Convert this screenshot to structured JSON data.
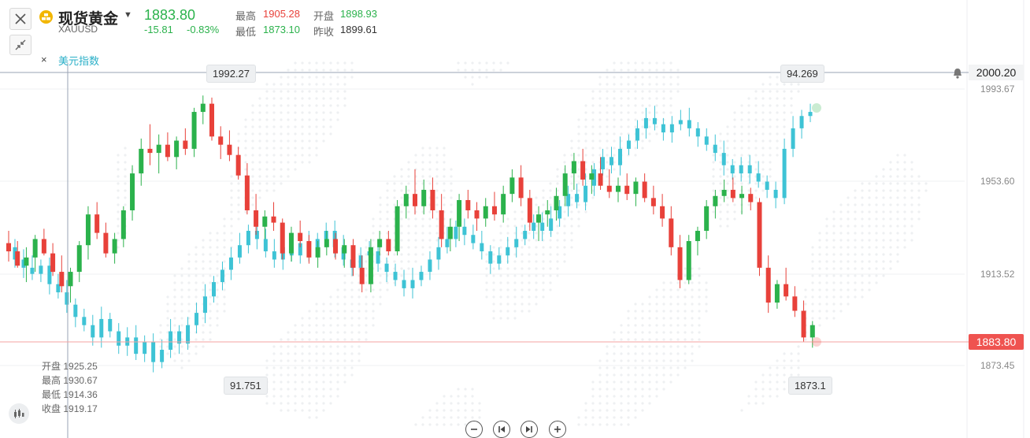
{
  "header": {
    "symbol_name": "现货黄金",
    "symbol_code": "XAUUSD",
    "last_price": "1883.80",
    "change": "-15.81",
    "change_pct": "-0.83%",
    "high_label": "最高",
    "high_value": "1905.28",
    "open_label": "开盘",
    "open_value": "1898.93",
    "low_label": "最低",
    "low_value": "1873.10",
    "prev_close_label": "昨收",
    "prev_close_value": "1899.61"
  },
  "indicator": {
    "close_glyph": "×",
    "name": "美元指数"
  },
  "crosshair": {
    "price_label": "2000.20"
  },
  "current_price_label": "1883.80",
  "annotations": {
    "gold_max": "1992.27",
    "gold_min": "1873.1",
    "dxy_max": "94.269",
    "dxy_min": "91.751"
  },
  "ohlc_panel": {
    "open_label": "开盘",
    "open_value": "1925.25",
    "high_label": "最高",
    "high_value": "1930.67",
    "low_label": "最低",
    "low_value": "1914.36",
    "close_label": "收盘",
    "close_value": "1919.17"
  },
  "colors": {
    "up": "#2bb24c",
    "down": "#e8413a",
    "dxy": "#3ec3d5",
    "accent_red": "#ef5350"
  },
  "chart_data": {
    "type": "candlestick",
    "y_axis": {
      "ticks": [
        "1993.67",
        "1953.60",
        "1913.52",
        "1873.45"
      ],
      "range": [
        1862,
        2008
      ]
    },
    "series": [
      {
        "name": "现货黄金",
        "ohlc": [
          [
            1924,
            1930,
            1915,
            1920
          ],
          [
            1920,
            1925,
            1912,
            1913
          ],
          [
            1913,
            1922,
            1905,
            1917
          ],
          [
            1917,
            1928,
            1910,
            1926
          ],
          [
            1926,
            1931,
            1918,
            1919
          ],
          [
            1919,
            1924,
            1908,
            1910
          ],
          [
            1910,
            1918,
            1900,
            1903
          ],
          [
            1903,
            1912,
            1895,
            1910
          ],
          [
            1910,
            1925,
            1905,
            1923
          ],
          [
            1923,
            1942,
            1916,
            1938
          ],
          [
            1938,
            1944,
            1926,
            1929
          ],
          [
            1929,
            1934,
            1917,
            1919
          ],
          [
            1919,
            1929,
            1914,
            1926
          ],
          [
            1926,
            1942,
            1922,
            1940
          ],
          [
            1940,
            1962,
            1935,
            1958
          ],
          [
            1958,
            1975,
            1952,
            1970
          ],
          [
            1970,
            1982,
            1962,
            1968
          ],
          [
            1968,
            1977,
            1958,
            1972
          ],
          [
            1972,
            1978,
            1964,
            1966
          ],
          [
            1966,
            1976,
            1960,
            1974
          ],
          [
            1974,
            1980,
            1967,
            1970
          ],
          [
            1970,
            1990,
            1966,
            1988
          ],
          [
            1988,
            1996,
            1982,
            1992
          ],
          [
            1992,
            1995,
            1974,
            1976
          ],
          [
            1976,
            1981,
            1965,
            1972
          ],
          [
            1972,
            1979,
            1964,
            1967
          ],
          [
            1967,
            1971,
            1955,
            1957
          ],
          [
            1957,
            1963,
            1938,
            1940
          ],
          [
            1940,
            1948,
            1928,
            1932
          ],
          [
            1932,
            1940,
            1926,
            1937
          ],
          [
            1937,
            1944,
            1930,
            1934
          ],
          [
            1934,
            1936,
            1916,
            1919
          ],
          [
            1919,
            1932,
            1915,
            1929
          ],
          [
            1929,
            1935,
            1922,
            1925
          ],
          [
            1925,
            1928,
            1914,
            1917
          ],
          [
            1917,
            1925,
            1912,
            1922
          ],
          [
            1922,
            1930,
            1918,
            1926
          ],
          [
            1926,
            1929,
            1916,
            1919
          ],
          [
            1919,
            1926,
            1912,
            1923
          ],
          [
            1923,
            1926,
            1908,
            1912
          ],
          [
            1912,
            1918,
            1900,
            1904
          ],
          [
            1904,
            1926,
            1900,
            1922
          ],
          [
            1922,
            1930,
            1918,
            1926
          ],
          [
            1926,
            1930,
            1918,
            1920
          ],
          [
            1920,
            1945,
            1918,
            1942
          ],
          [
            1942,
            1952,
            1936,
            1948
          ],
          [
            1948,
            1960,
            1938,
            1942
          ],
          [
            1942,
            1955,
            1938,
            1950
          ],
          [
            1950,
            1956,
            1936,
            1940
          ],
          [
            1940,
            1948,
            1922,
            1926
          ],
          [
            1926,
            1936,
            1920,
            1932
          ],
          [
            1932,
            1948,
            1925,
            1945
          ],
          [
            1945,
            1950,
            1936,
            1940
          ],
          [
            1940,
            1944,
            1930,
            1936
          ],
          [
            1936,
            1946,
            1932,
            1942
          ],
          [
            1942,
            1949,
            1935,
            1938
          ],
          [
            1938,
            1952,
            1934,
            1948
          ],
          [
            1948,
            1960,
            1944,
            1956
          ],
          [
            1956,
            1962,
            1942,
            1946
          ],
          [
            1946,
            1950,
            1930,
            1934
          ],
          [
            1934,
            1942,
            1925,
            1938
          ],
          [
            1938,
            1945,
            1932,
            1940
          ],
          [
            1940,
            1951,
            1935,
            1947
          ],
          [
            1947,
            1962,
            1942,
            1958
          ],
          [
            1958,
            1968,
            1950,
            1964
          ],
          [
            1964,
            1970,
            1952,
            1955
          ],
          [
            1955,
            1962,
            1948,
            1958
          ],
          [
            1958,
            1966,
            1950,
            1952
          ],
          [
            1952,
            1960,
            1946,
            1949
          ],
          [
            1949,
            1956,
            1944,
            1952
          ],
          [
            1952,
            1958,
            1945,
            1948
          ],
          [
            1948,
            1956,
            1942,
            1954
          ],
          [
            1954,
            1958,
            1944,
            1946
          ],
          [
            1946,
            1952,
            1938,
            1942
          ],
          [
            1942,
            1948,
            1932,
            1936
          ],
          [
            1936,
            1942,
            1918,
            1922
          ],
          [
            1922,
            1928,
            1902,
            1906
          ],
          [
            1906,
            1928,
            1904,
            1925
          ],
          [
            1925,
            1932,
            1918,
            1930
          ],
          [
            1930,
            1945,
            1926,
            1942
          ],
          [
            1942,
            1950,
            1936,
            1947
          ],
          [
            1947,
            1955,
            1944,
            1950
          ],
          [
            1950,
            1956,
            1944,
            1946
          ],
          [
            1946,
            1952,
            1938,
            1948
          ],
          [
            1948,
            1951,
            1940,
            1944
          ],
          [
            1944,
            1946,
            1908,
            1912
          ],
          [
            1912,
            1918,
            1890,
            1895
          ],
          [
            1895,
            1906,
            1892,
            1904
          ],
          [
            1904,
            1912,
            1896,
            1898
          ],
          [
            1898,
            1903,
            1888,
            1891
          ],
          [
            1891,
            1896,
            1876,
            1878
          ],
          [
            1878,
            1886,
            1873,
            1884
          ]
        ]
      },
      {
        "name": "美元指数",
        "close_scaled": [
          1922,
          1916,
          1912,
          1909,
          1913,
          1904,
          1900,
          1894,
          1888,
          1884,
          1878,
          1887,
          1881,
          1874,
          1878,
          1870,
          1876,
          1866,
          1872,
          1881,
          1875,
          1884,
          1890,
          1898,
          1905,
          1911,
          1917,
          1923,
          1930,
          1926,
          1920,
          1916,
          1922,
          1918,
          1924,
          1920,
          1926,
          1930,
          1922,
          1916,
          1912,
          1918,
          1920,
          1914,
          1910,
          1906,
          1902,
          1906,
          1910,
          1916,
          1922,
          1926,
          1932,
          1928,
          1924,
          1920,
          1914,
          1918,
          1922,
          1926,
          1930,
          1934,
          1930,
          1936,
          1942,
          1948,
          1944,
          1952,
          1960,
          1966,
          1962,
          1970,
          1974,
          1980,
          1985,
          1982,
          1978,
          1982,
          1984,
          1980,
          1976,
          1972,
          1968,
          1962,
          1958,
          1962,
          1958,
          1954,
          1950,
          1946,
          1970,
          1980,
          1986,
          1988
        ]
      }
    ]
  }
}
